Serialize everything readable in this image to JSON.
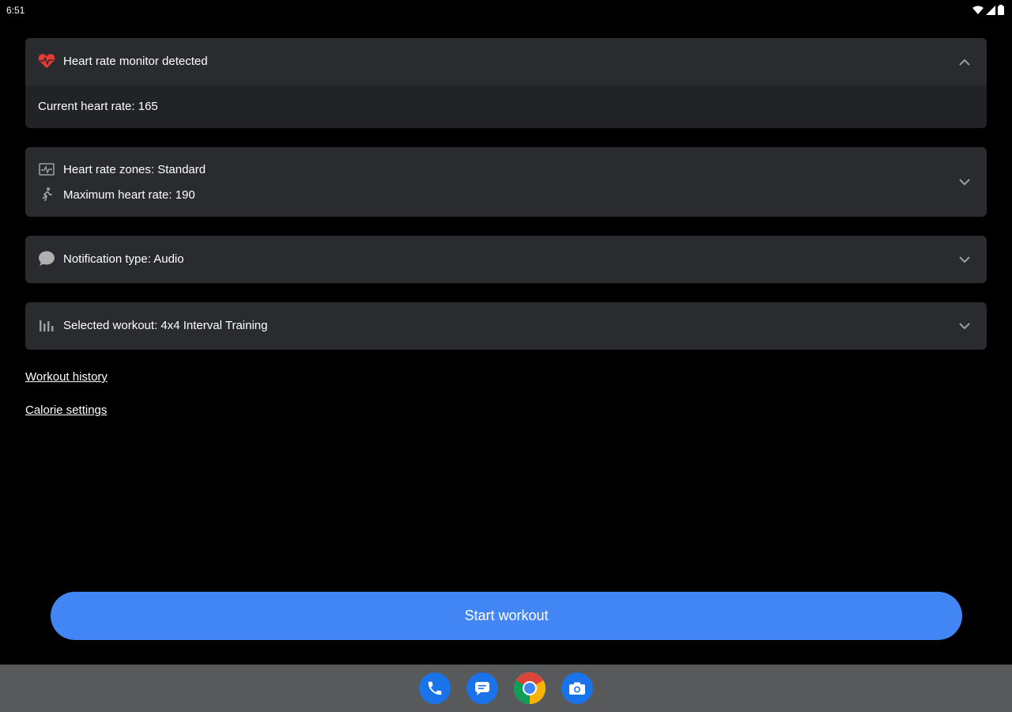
{
  "status_bar": {
    "time": "6:51"
  },
  "heart_rate_card": {
    "title": "Heart rate monitor detected",
    "current_rate_text": "Current heart rate: 165",
    "expanded": true
  },
  "zones_card": {
    "zones_text": "Heart rate zones: Standard",
    "max_rate_text": "Maximum heart rate: 190"
  },
  "notification_card": {
    "text": "Notification type: Audio"
  },
  "workout_card": {
    "text": "Selected workout: 4x4 Interval Training"
  },
  "links": {
    "workout_history": "Workout history",
    "calorie_settings": "Calorie settings"
  },
  "start_button": {
    "label": "Start workout"
  },
  "taskbar": {
    "apps": [
      "phone-icon",
      "messages-icon",
      "chrome-icon",
      "camera-icon"
    ]
  },
  "colors": {
    "background": "#000000",
    "card": "#2a2b2e",
    "accent": "#4285f4",
    "heart": "#e53935",
    "taskbar": "#58595b"
  }
}
